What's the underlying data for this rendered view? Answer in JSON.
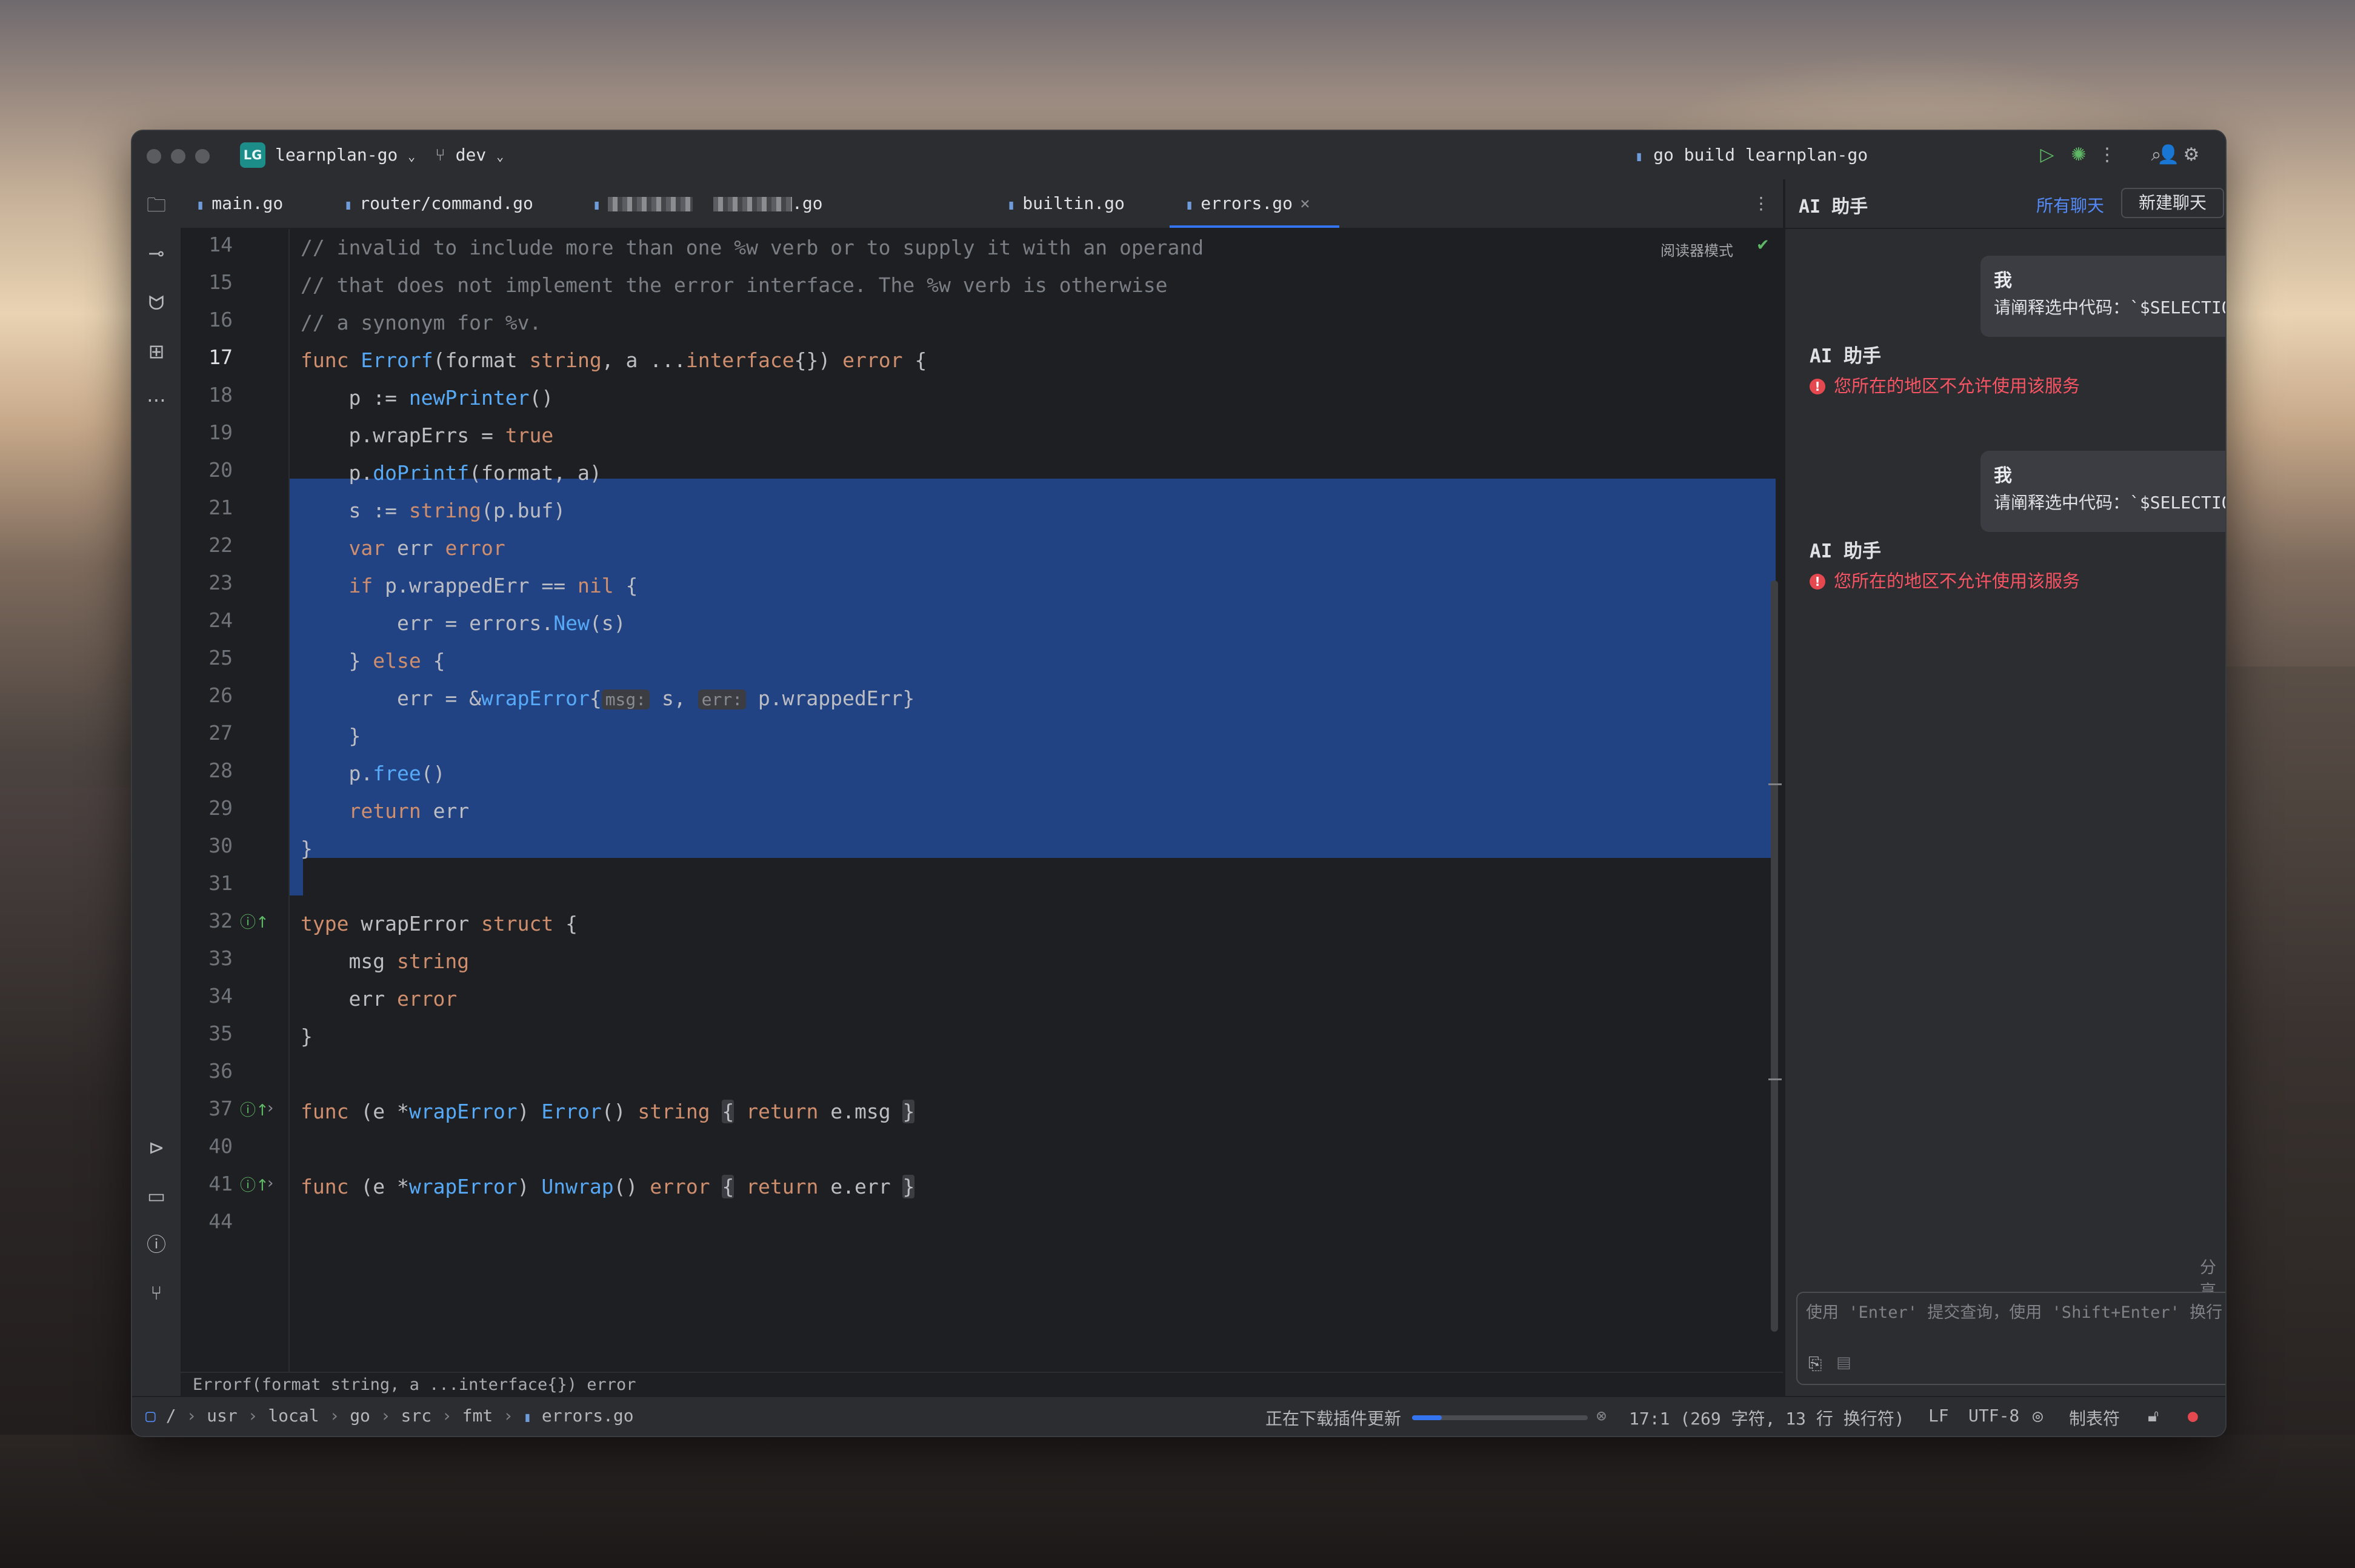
{
  "window": {
    "project_badge": "LG",
    "project_name": "learnplan-go",
    "branch": "dev",
    "run_config": "go build learnplan-go"
  },
  "tabs": [
    {
      "label": "main.go",
      "active": false
    },
    {
      "label": "router/command.go",
      "active": false
    },
    {
      "label": ".go",
      "active": false
    },
    {
      "label": "builtin.go",
      "active": false
    },
    {
      "label": "errors.go",
      "active": true
    }
  ],
  "editor": {
    "reader_mode": "阅读器模式",
    "line_numbers": [
      "14",
      "15",
      "16",
      "17",
      "18",
      "19",
      "20",
      "21",
      "22",
      "23",
      "24",
      "25",
      "26",
      "27",
      "28",
      "29",
      "30",
      "31",
      "32",
      "33",
      "34",
      "35",
      "36",
      "37",
      "40",
      "41",
      "44"
    ],
    "current_line": "17",
    "code_lines": [
      "// invalid to include more than one %w verb or to supply it with an operand",
      "// that does not implement the error interface. The %w verb is otherwise",
      "// a synonym for %v.",
      "func Errorf(format string, a ...interface{}) error {",
      "    p := newPrinter()",
      "    p.wrapErrs = true",
      "    p.doPrintf(format, a)",
      "    s := string(p.buf)",
      "    var err error",
      "    if p.wrappedErr == nil {",
      "        err = errors.New(s)",
      "    } else {",
      "        err = &wrapError{msg: s, err: p.wrappedErr}",
      "    }",
      "    p.free()",
      "    return err",
      "}",
      "",
      "type wrapError struct {",
      "    msg string",
      "    err error",
      "}",
      "",
      "func (e *wrapError) Error() string { return e.msg }",
      "",
      "func (e *wrapError) Unwrap() error { return e.err }",
      ""
    ],
    "param_hints": {
      "msg": "msg:",
      "err": "err:"
    },
    "signature_hint": "Errorf(format string, a ...interface{}) error"
  },
  "breadcrumb": [
    "/",
    "usr",
    "local",
    "go",
    "src",
    "fmt",
    "errors.go"
  ],
  "ai": {
    "title": "AI 助手",
    "all_chats": "所有聊天",
    "new_chat": "新建聊天",
    "messages": [
      {
        "role": "user",
        "name": "我",
        "text": "请阐释选中代码：`$SELECTION`"
      },
      {
        "role": "assistant",
        "name": "AI 助手",
        "text": "您所在的地区不允许使用该服务"
      },
      {
        "role": "user",
        "name": "我",
        "text": "请阐释选中代码：`$SELECTION`"
      },
      {
        "role": "assistant",
        "name": "AI 助手",
        "text": "您所在的地区不允许使用该服务"
      }
    ],
    "share_feedback": "分享反馈 ↗",
    "input_placeholder": "使用 'Enter' 提交查询，使用 'Shift+Enter' 换行"
  },
  "status": {
    "downloading": "正在下载插件更新",
    "progress": 0.17,
    "position": "17:1 (269 字符, 13 行 换行符)",
    "line_sep": "LF",
    "encoding": "UTF-8",
    "indent": "制表符"
  },
  "colors": {
    "accent": "#3574f0",
    "selection": "#214283",
    "error": "#f75464",
    "keyword": "#cf8e6d",
    "function": "#56a8f5"
  }
}
